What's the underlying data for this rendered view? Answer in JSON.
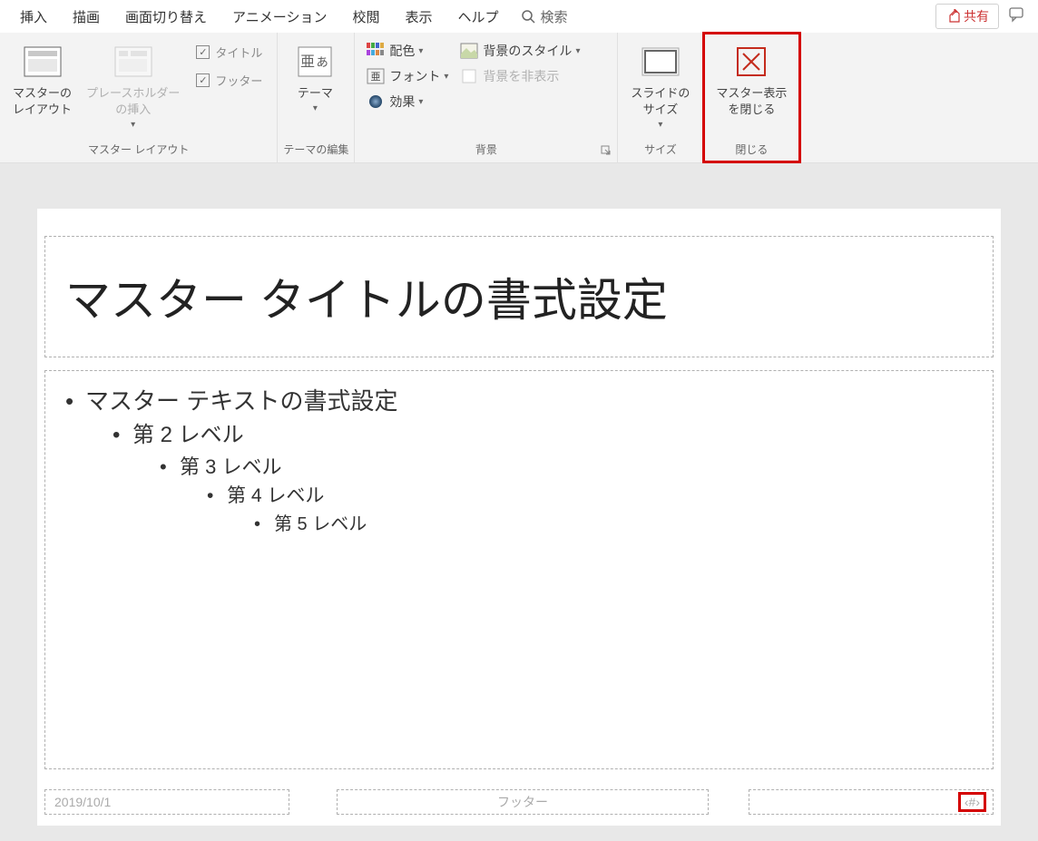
{
  "tabs": [
    "挿入",
    "描画",
    "画面切り替え",
    "アニメーション",
    "校閲",
    "表示",
    "ヘルプ"
  ],
  "search_label": "検索",
  "share_label": "共有",
  "ribbon": {
    "group1": {
      "label": "マスター レイアウト",
      "master_layout": "マスターの\nレイアウト",
      "placeholder_insert": "プレースホルダー\nの挿入",
      "chk_title": "タイトル",
      "chk_footer": "フッター"
    },
    "group2": {
      "label": "テーマの編集",
      "theme": "テーマ"
    },
    "group3": {
      "label": "背景",
      "color_scheme": "配色",
      "font": "フォント",
      "effect": "効果",
      "bg_style": "背景のスタイル",
      "hide_bg": "背景を非表示"
    },
    "group4": {
      "label": "サイズ",
      "slide_size": "スライドの\nサイズ"
    },
    "group5": {
      "label": "閉じる",
      "close_master": "マスター表示\nを閉じる"
    }
  },
  "slide": {
    "title": "マスター タイトルの書式設定",
    "levels": [
      "マスター テキストの書式設定",
      "第 2 レベル",
      "第 3 レベル",
      "第 4 レベル",
      "第 5 レベル"
    ],
    "date": "2019/10/1",
    "footer": "フッター",
    "pagenum": "‹#›"
  }
}
